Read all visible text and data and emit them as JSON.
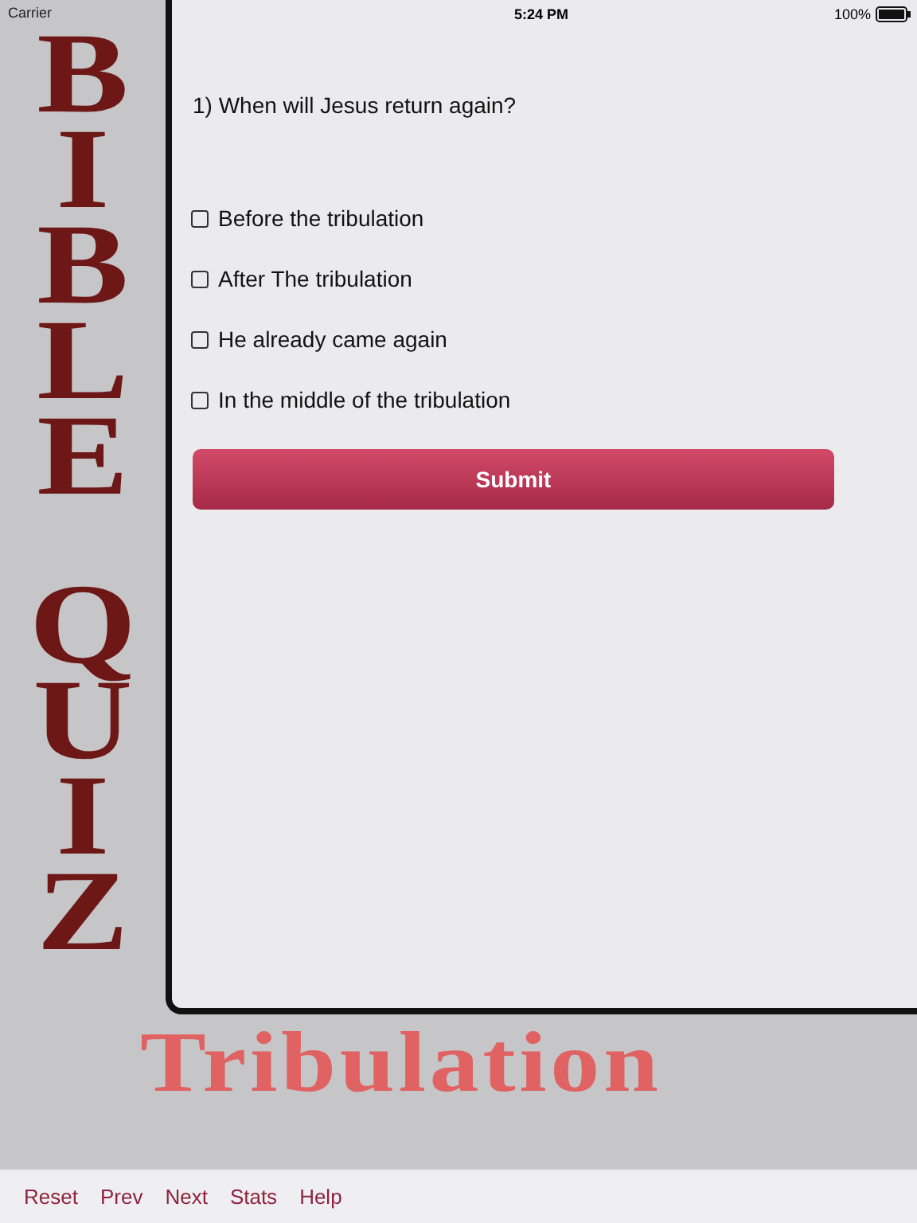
{
  "status_bar": {
    "carrier": "Carrier",
    "time": "5:24 PM",
    "battery": "100%"
  },
  "title_words": [
    "BIBLE",
    "QUIZ"
  ],
  "subtitle": "Tribulation",
  "question": "1) When will Jesus return again?",
  "options": [
    {
      "label": "Before the tribulation",
      "checked": false
    },
    {
      "label": "After The tribulation",
      "checked": false
    },
    {
      "label": "He already came again",
      "checked": false
    },
    {
      "label": "In the middle of the tribulation",
      "checked": false
    }
  ],
  "submit": "Submit",
  "toolbar": [
    "Reset",
    "Prev",
    "Next",
    "Stats",
    "Help"
  ]
}
